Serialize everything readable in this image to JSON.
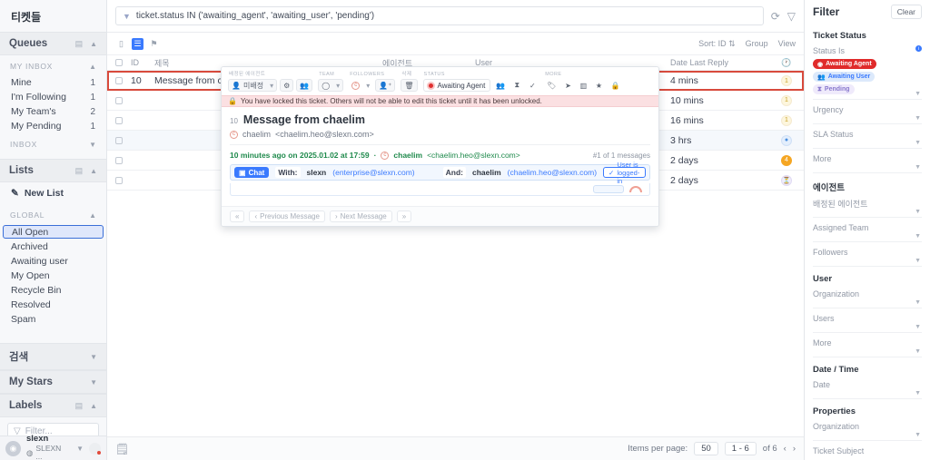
{
  "sidebar": {
    "title": "티켓들",
    "sections": [
      {
        "name": "queues",
        "label": "Queues",
        "groups": [
          {
            "label": "MY INBOX",
            "items": [
              {
                "label": "Mine",
                "count": "1"
              },
              {
                "label": "I'm Following",
                "count": "1"
              },
              {
                "label": "My Team's",
                "count": "2"
              },
              {
                "label": "My Pending",
                "count": "1"
              }
            ]
          },
          {
            "label": "INBOX",
            "items": []
          }
        ]
      },
      {
        "name": "lists",
        "label": "Lists",
        "new_list_label": "New List",
        "groups": [
          {
            "label": "GLOBAL",
            "items": [
              {
                "label": "All Open",
                "count": "",
                "selected": true
              },
              {
                "label": "Archived",
                "count": ""
              },
              {
                "label": "Awaiting user",
                "count": ""
              },
              {
                "label": "My Open",
                "count": ""
              },
              {
                "label": "Recycle Bin",
                "count": ""
              },
              {
                "label": "Resolved",
                "count": ""
              },
              {
                "label": "Spam",
                "count": ""
              }
            ]
          }
        ]
      }
    ],
    "collapsed_sections": [
      {
        "label": "검색"
      },
      {
        "label": "My Stars"
      },
      {
        "label": "Labels"
      }
    ],
    "filter_placeholder": "Filter...",
    "user": {
      "name": "slexn",
      "org": "SLEXN ..."
    }
  },
  "query": {
    "text": "ticket.status IN ('awaiting_agent', 'awaiting_user', 'pending')",
    "refresh_icon": "refresh-icon",
    "filter_icon": "filter-icon"
  },
  "list_tools": {
    "view_modes": [
      "card-view-icon",
      "list-view-icon",
      "kanban-view-icon"
    ],
    "active_view_index": 1,
    "sort_label": "Sort: ID",
    "group_label": "Group",
    "view_label": "View"
  },
  "table": {
    "columns": [
      "ID",
      "제목",
      "에이전트",
      "User",
      "Date Last Reply",
      ""
    ],
    "rows": [
      {
        "id": "10",
        "subject": "Message from chaelim",
        "locked": true,
        "agent": "",
        "user": "",
        "date": "4 mins",
        "badge": "1",
        "badge_style": "cream",
        "selected": true
      },
      {
        "id": "",
        "subject": "",
        "agent": "",
        "user": "",
        "date": "10 mins",
        "badge": "1",
        "badge_style": "cream"
      },
      {
        "id": "",
        "subject": "",
        "agent": "",
        "user": "",
        "date": "16 mins",
        "badge": "1",
        "badge_style": "cream"
      },
      {
        "id": "",
        "subject": "",
        "agent": "",
        "user": "",
        "date": "3 hrs",
        "badge": "●",
        "badge_style": "blue",
        "alt": true
      },
      {
        "id": "",
        "subject": "",
        "agent": "",
        "user": "",
        "date": "2 days",
        "badge": "4",
        "badge_style": "orange"
      },
      {
        "id": "",
        "subject": "",
        "agent": "",
        "user": "",
        "date": "2 days",
        "badge": "⏳",
        "badge_style": "purple"
      }
    ]
  },
  "footer": {
    "items_per_page_label": "Items per page:",
    "items_per_page_value": "50",
    "range": "1 - 6",
    "total": "of 6",
    "export_icon": "export-icon"
  },
  "popup": {
    "toolbar": {
      "groups": [
        {
          "caption": "배정된 에이전트",
          "buttons": [
            {
              "label": "미배정",
              "icon": "person-icon",
              "caret": true
            },
            {
              "label": "",
              "icon": "gear-icon"
            },
            {
              "label": "",
              "icon": "person-add-icon"
            }
          ]
        },
        {
          "caption": "TEAM",
          "buttons": [
            {
              "label": "",
              "icon": "team-icon",
              "caret": true
            }
          ]
        },
        {
          "caption": "FOLLOWERS",
          "buttons": [
            {
              "label": "",
              "icon": "avatar-icon",
              "caret": true
            },
            {
              "label": "",
              "icon": "follower-add-icon"
            }
          ]
        },
        {
          "caption": "삭제",
          "buttons": [
            {
              "label": "",
              "icon": "trash-icon"
            }
          ]
        },
        {
          "caption": "STATUS",
          "buttons": [
            {
              "label": "Awaiting Agent",
              "icon": "status-dot-icon"
            },
            {
              "label": "",
              "icon": "assign-user-icon"
            },
            {
              "label": "",
              "icon": "pending-icon"
            },
            {
              "label": "",
              "icon": "resolve-check-icon"
            }
          ]
        },
        {
          "caption": "MORE",
          "buttons": [
            {
              "label": "",
              "icon": "tag-icon"
            },
            {
              "label": "",
              "icon": "send-icon"
            },
            {
              "label": "",
              "icon": "merge-icon"
            },
            {
              "label": "",
              "icon": "star-icon"
            },
            {
              "label": "",
              "icon": "lock-icon"
            }
          ]
        }
      ]
    },
    "lock_notice": "You have locked this ticket. Others will not be able to edit this ticket until it has been unlocked.",
    "ticket_number": "10",
    "ticket_title": "Message from chaelim",
    "from_name": "chaelim",
    "from_email": "<chaelim.heo@slexn.com>",
    "message_when": "10 minutes ago on 2025.01.02 at 17:59",
    "message_sep": "·",
    "message_author": "chaelim",
    "message_author_email": "<chaelim.heo@slexn.com>",
    "message_count": "#1 of 1 messages",
    "chat": {
      "type_label": "Chat",
      "with_label": "With:",
      "with_name": "slexn",
      "with_email": "(enterprise@slexn.com)",
      "and_label": "And:",
      "and_name": "chaelim",
      "and_email": "(chaelim.heo@slexn.com)",
      "status": "User is logged-in"
    },
    "nav": {
      "first": "«",
      "previous": "Previous Message",
      "next": "Next Message",
      "last": "»"
    }
  },
  "filter_panel": {
    "title": "Filter",
    "clear_label": "Clear",
    "sections": [
      {
        "heading": "Ticket Status",
        "fields": [
          {
            "label": "Status Is",
            "has_info": true,
            "chips": [
              {
                "text": "Awaiting Agent",
                "style": "red"
              },
              {
                "text": "Awaiting User",
                "style": "blue"
              },
              {
                "text": "Pending",
                "style": "purple"
              }
            ]
          },
          {
            "label": "Urgency"
          },
          {
            "label": "SLA Status"
          },
          {
            "label": "More"
          }
        ]
      },
      {
        "heading": "에이전트",
        "fields": [
          {
            "label": "배정된 에이전트"
          },
          {
            "label": "Assigned Team"
          },
          {
            "label": "Followers"
          }
        ]
      },
      {
        "heading": "User",
        "fields": [
          {
            "label": "Organization"
          },
          {
            "label": "Users"
          },
          {
            "label": "More"
          }
        ]
      },
      {
        "heading": "Date / Time",
        "fields": [
          {
            "label": "Date"
          }
        ]
      },
      {
        "heading": "Properties",
        "fields": [
          {
            "label": "Organization"
          },
          {
            "label": "Ticket Subject"
          }
        ]
      }
    ]
  }
}
